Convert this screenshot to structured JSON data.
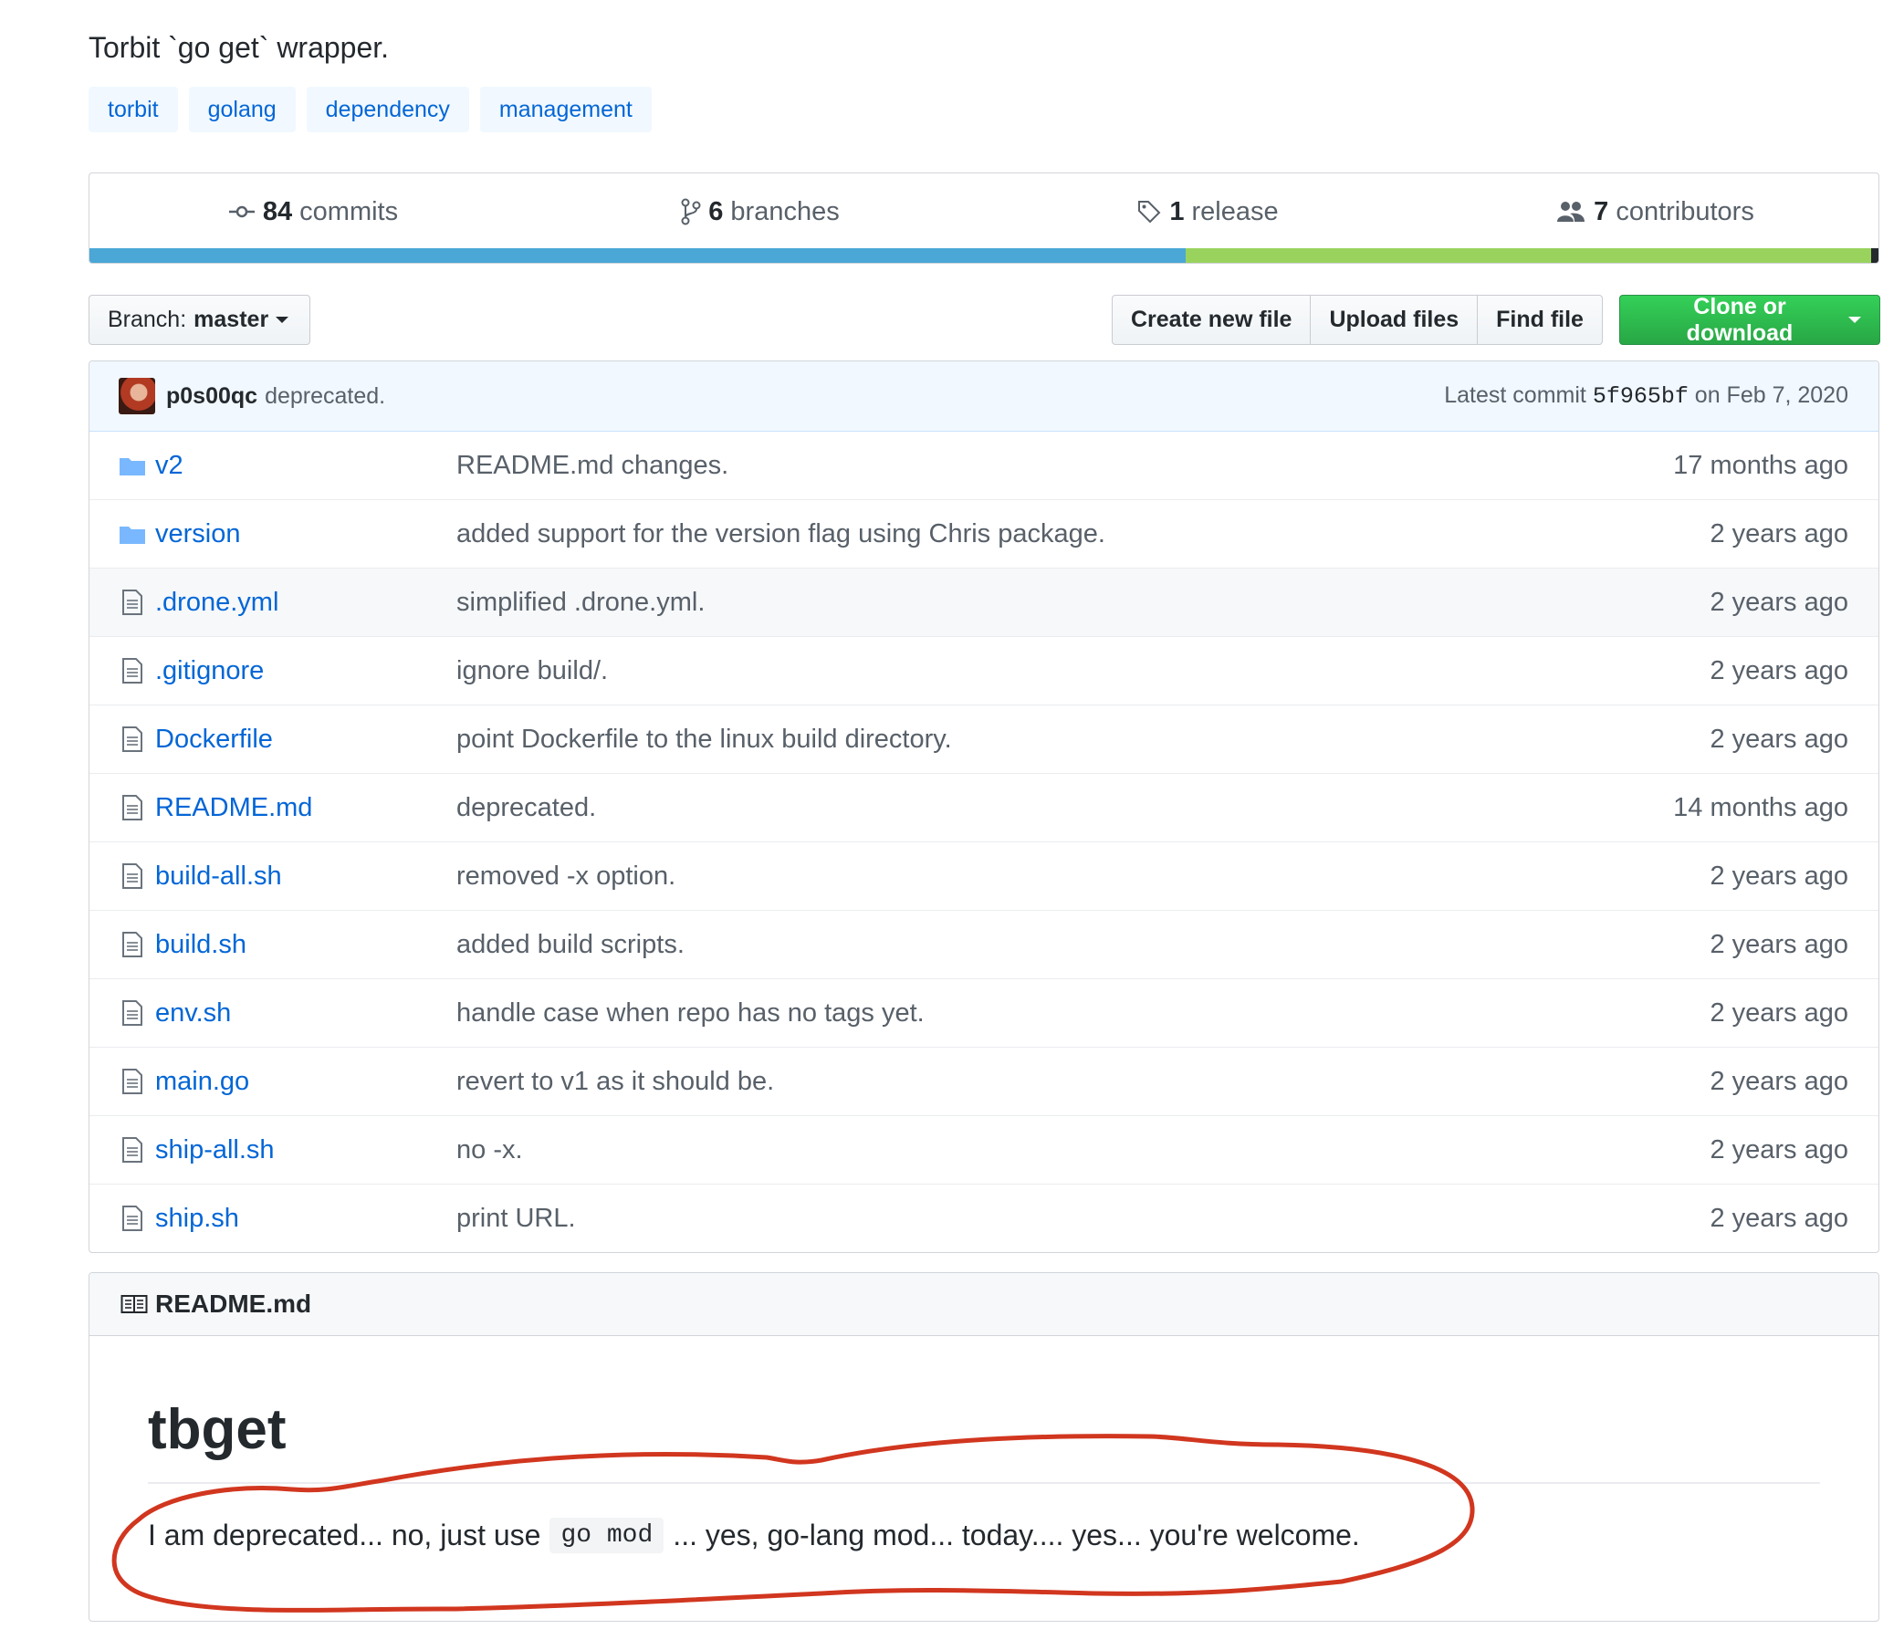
{
  "repo": {
    "description": "Torbit `go get` wrapper.",
    "topics": [
      "torbit",
      "golang",
      "dependency",
      "management"
    ]
  },
  "summary": {
    "commits_count": "84",
    "commits_label": "commits",
    "branches_count": "6",
    "branches_label": "branches",
    "releases_count": "1",
    "releases_label": "release",
    "contributors_count": "7",
    "contributors_label": "contributors",
    "languages": [
      {
        "color": "#4aa7d6",
        "share": 0.613
      },
      {
        "color": "#99d35e",
        "share": 0.383
      },
      {
        "color": "#24292e",
        "share": 0.004
      }
    ]
  },
  "toolbar": {
    "branch_prefix": "Branch:",
    "branch_name": "master",
    "create_file": "Create new file",
    "upload_files": "Upload files",
    "find_file": "Find file",
    "clone": "Clone or download"
  },
  "latest_commit": {
    "author": "p0s00qc",
    "message": "deprecated.",
    "prefix": "Latest commit",
    "sha": "5f965bf",
    "date": "on Feb 7, 2020"
  },
  "files": [
    {
      "type": "dir",
      "name": "v2",
      "message": "README.md changes.",
      "age": "17 months ago"
    },
    {
      "type": "dir",
      "name": "version",
      "message": "added support for the version flag using Chris package.",
      "age": "2 years ago"
    },
    {
      "type": "file",
      "name": ".drone.yml",
      "message": "simplified .drone.yml.",
      "age": "2 years ago"
    },
    {
      "type": "file",
      "name": ".gitignore",
      "message": "ignore build/.",
      "age": "2 years ago"
    },
    {
      "type": "file",
      "name": "Dockerfile",
      "message": "point Dockerfile to the linux build directory.",
      "age": "2 years ago"
    },
    {
      "type": "file",
      "name": "README.md",
      "message": "deprecated.",
      "age": "14 months ago"
    },
    {
      "type": "file",
      "name": "build-all.sh",
      "message": "removed -x option.",
      "age": "2 years ago"
    },
    {
      "type": "file",
      "name": "build.sh",
      "message": "added build scripts.",
      "age": "2 years ago"
    },
    {
      "type": "file",
      "name": "env.sh",
      "message": "handle case when repo has no tags yet.",
      "age": "2 years ago"
    },
    {
      "type": "file",
      "name": "main.go",
      "message": "revert to v1 as it should be.",
      "age": "2 years ago"
    },
    {
      "type": "file",
      "name": "ship-all.sh",
      "message": "no -x.",
      "age": "2 years ago"
    },
    {
      "type": "file",
      "name": "ship.sh",
      "message": "print URL.",
      "age": "2 years ago"
    }
  ],
  "readme": {
    "header": "README.md",
    "title": "tbget",
    "text_before": "I am deprecated... no, just use",
    "code": "go mod",
    "text_after": "... yes, go-lang mod... today.... yes... you're welcome."
  },
  "colors": {
    "link": "#0366d6",
    "annotation": "#d1361f",
    "clone_button": "#28a745"
  }
}
